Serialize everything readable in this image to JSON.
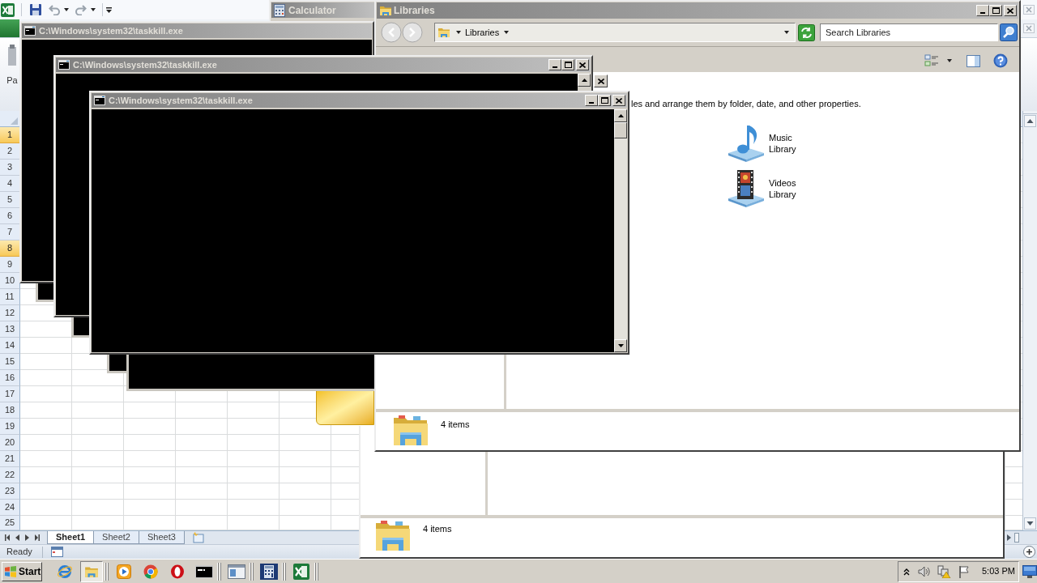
{
  "excel": {
    "paste_label": "Pa",
    "row_headers": [
      {
        "label": "1",
        "selected": true
      },
      {
        "label": "2",
        "selected": false
      },
      {
        "label": "3",
        "selected": false
      },
      {
        "label": "4",
        "selected": false
      },
      {
        "label": "5",
        "selected": false
      },
      {
        "label": "6",
        "selected": false
      },
      {
        "label": "7",
        "selected": false
      },
      {
        "label": "8",
        "selected": true
      },
      {
        "label": "9",
        "selected": false
      },
      {
        "label": "10",
        "selected": false
      },
      {
        "label": "11",
        "selected": false
      },
      {
        "label": "12",
        "selected": false
      },
      {
        "label": "13",
        "selected": false
      },
      {
        "label": "14",
        "selected": false
      },
      {
        "label": "15",
        "selected": false
      },
      {
        "label": "16",
        "selected": false
      },
      {
        "label": "17",
        "selected": false
      },
      {
        "label": "18",
        "selected": false
      },
      {
        "label": "19",
        "selected": false
      },
      {
        "label": "20",
        "selected": false
      },
      {
        "label": "21",
        "selected": false
      },
      {
        "label": "22",
        "selected": false
      },
      {
        "label": "23",
        "selected": false
      },
      {
        "label": "24",
        "selected": false
      },
      {
        "label": "25",
        "selected": false
      }
    ],
    "sheet_tabs": [
      {
        "label": "Sheet1",
        "selected": true
      },
      {
        "label": "Sheet2",
        "selected": false
      },
      {
        "label": "Sheet3",
        "selected": false
      }
    ],
    "status": "Ready"
  },
  "calculator": {
    "title": "Calculator"
  },
  "consoles": [
    {
      "title": "C:\\Windows\\system32\\taskkill.exe"
    },
    {
      "title": "C:\\Windows\\system32\\taskkill.exe"
    },
    {
      "title": "C:\\Windows\\system32\\taskkill.exe"
    }
  ],
  "libraries": {
    "title": "Libraries",
    "address": "Libraries",
    "search": {
      "placeholder": "Search Libraries"
    },
    "description": "les and arrange them by folder, date, and other properties.",
    "items": [
      {
        "kind": "music",
        "name": "Music Library"
      },
      {
        "kind": "videos",
        "name": "Videos Library"
      }
    ],
    "status": "4 items"
  },
  "background_explorer": {
    "status": "4 items"
  },
  "taskbar": {
    "start": "Start",
    "apps": [
      {
        "kind": "ie",
        "selected": false
      },
      {
        "kind": "explorer",
        "selected": true
      },
      {
        "kind": "media",
        "selected": false
      },
      {
        "kind": "chrome",
        "selected": false
      },
      {
        "kind": "opera",
        "selected": false
      },
      {
        "kind": "console",
        "selected": false
      },
      {
        "kind": "window",
        "selected": false
      },
      {
        "kind": "calculator",
        "selected": false
      },
      {
        "kind": "excel",
        "selected": false
      }
    ],
    "clock": "5:03 PM"
  }
}
